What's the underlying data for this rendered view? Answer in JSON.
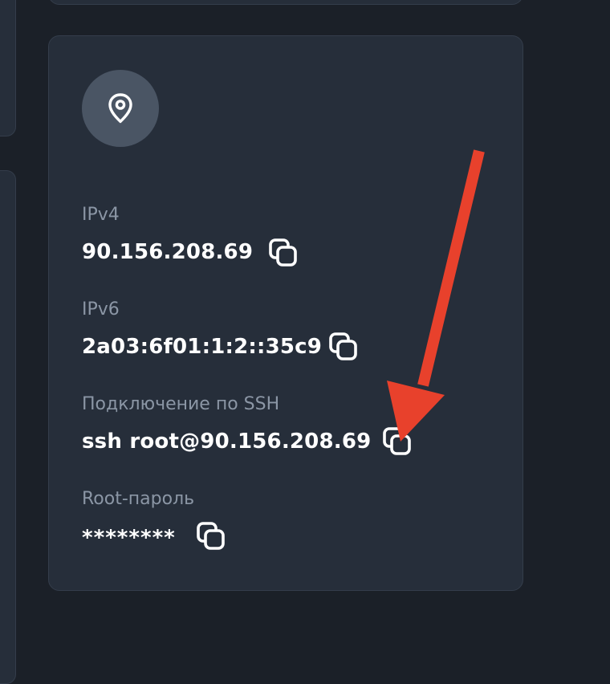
{
  "server_info": {
    "ipv4": {
      "label": "IPv4",
      "value": "90.156.208.69"
    },
    "ipv6": {
      "label": "IPv6",
      "value": "2a03:6f01:1:2::35c9"
    },
    "ssh": {
      "label": "Подключение по SSH",
      "value": "ssh root@90.156.208.69"
    },
    "root_password": {
      "label": "Root-пароль",
      "value": "********"
    }
  },
  "icons": {
    "location": "location-pin-icon",
    "copy": "copy-icon"
  },
  "colors": {
    "background": "#1b2028",
    "card": "#262e3a",
    "label": "#8b96a5",
    "value": "#ffffff",
    "icon_circle": "#4a5564",
    "annotation_arrow": "#e8412c"
  }
}
